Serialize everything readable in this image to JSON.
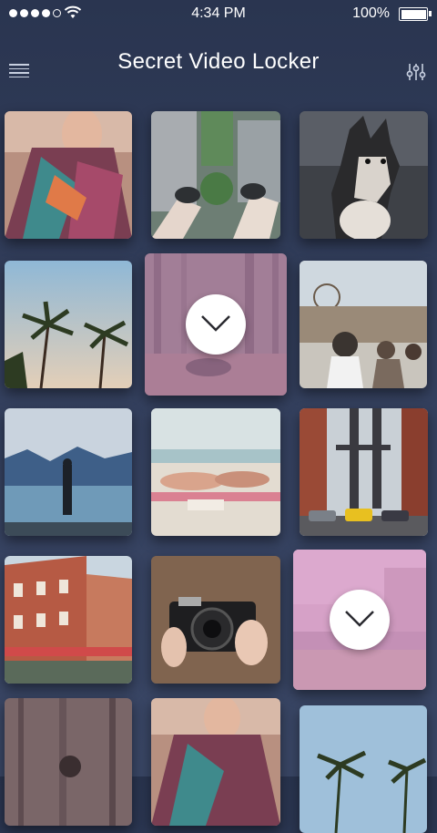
{
  "status": {
    "time": "4:34 PM",
    "battery": "100%"
  },
  "header": {
    "title": "Secret Video Locker",
    "menu_icon": "menu-icon",
    "settings_icon": "sliders-icon"
  },
  "tiles": [
    {
      "name": "photo-scarf-woman",
      "selected": false
    },
    {
      "name": "photo-feet-skyscrapers",
      "selected": false
    },
    {
      "name": "photo-husky-dog",
      "selected": false
    },
    {
      "name": "photo-palm-trees",
      "selected": false
    },
    {
      "name": "photo-forest-person",
      "selected": true
    },
    {
      "name": "photo-crowd-pier",
      "selected": false
    },
    {
      "name": "photo-lake-mountains",
      "selected": false
    },
    {
      "name": "photo-beach-sunbathers",
      "selected": false
    },
    {
      "name": "photo-bridge-street",
      "selected": false
    },
    {
      "name": "photo-red-building",
      "selected": false
    },
    {
      "name": "photo-hands-camera",
      "selected": false
    },
    {
      "name": "photo-pink-seaside",
      "selected": true
    },
    {
      "name": "photo-forest-figure",
      "selected": false
    },
    {
      "name": "photo-scarf-woman-2",
      "selected": false
    },
    {
      "name": "photo-palms-sky",
      "selected": false
    }
  ]
}
